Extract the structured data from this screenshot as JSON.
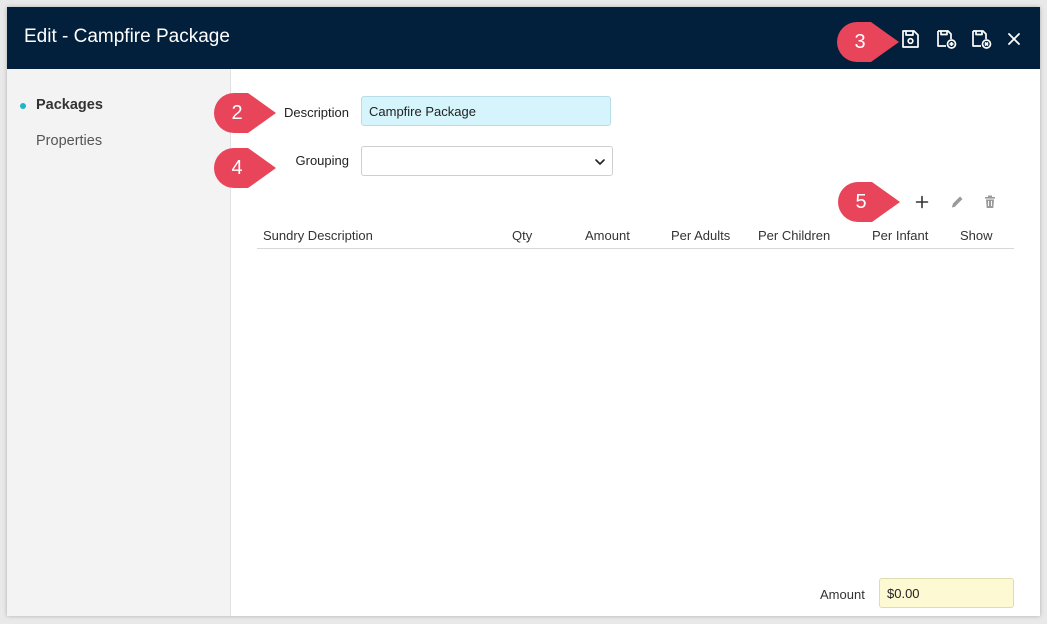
{
  "window": {
    "title": "Edit - Campfire Package",
    "toolbar": {
      "save": "save-icon",
      "save_new": "save-and-new-icon",
      "save_close": "save-and-close-icon",
      "close": "close-icon"
    }
  },
  "sidebar": {
    "items": [
      {
        "label": "Packages",
        "active": true
      },
      {
        "label": "Properties",
        "active": false
      }
    ]
  },
  "form": {
    "description_label": "Description",
    "description_value": "Campfire Package",
    "grouping_label": "Grouping",
    "grouping_value": ""
  },
  "table": {
    "columns": [
      "Sundry Description",
      "Qty",
      "Amount",
      "Per Adults",
      "Per Children",
      "Per Infant",
      "Show"
    ],
    "rows": []
  },
  "footer": {
    "amount_label": "Amount",
    "amount_value": "$0.00"
  },
  "callouts": [
    "2",
    "3",
    "4",
    "5"
  ],
  "colors": {
    "titlebar": "#02203b",
    "accent": "#1fb5c9",
    "callout": "#e8445a",
    "description_bg": "#d5f4fb",
    "amount_bg": "#fdf9d3"
  }
}
